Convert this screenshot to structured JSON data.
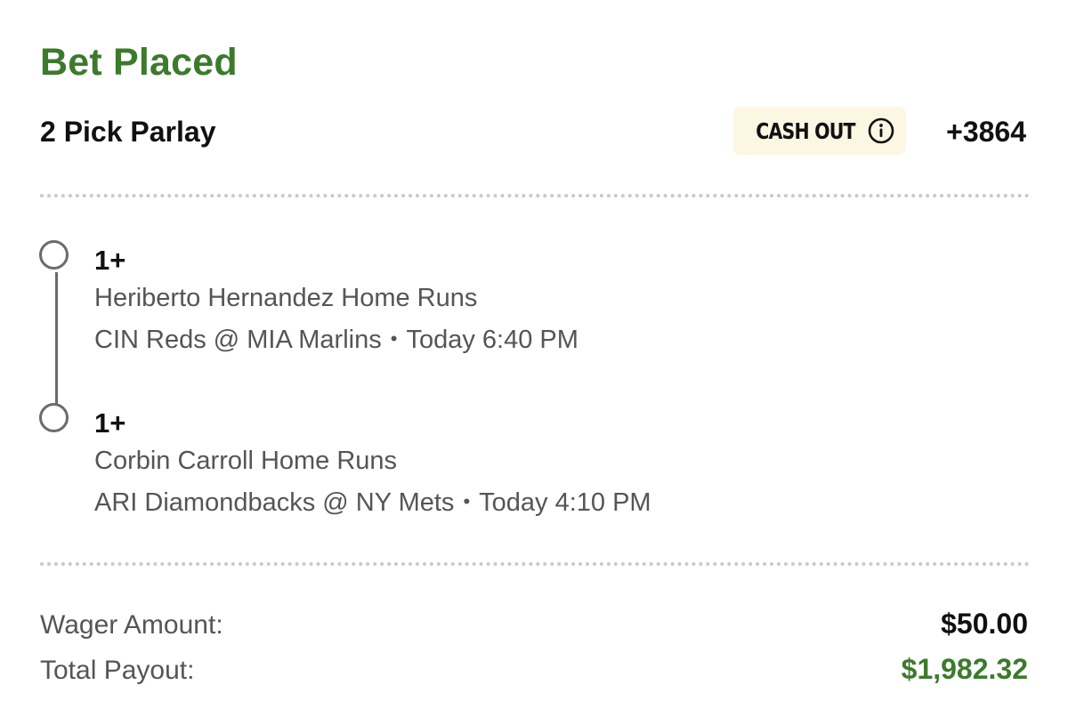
{
  "header": {
    "title": "Bet Placed",
    "bet_type": "2 Pick Parlay",
    "cashout_label": "CASH OUT",
    "odds": "+3864"
  },
  "legs": [
    {
      "line": "1+",
      "market": "Heriberto Hernandez Home Runs",
      "game": "CIN Reds @ MIA Marlins",
      "separator": "•",
      "time": "Today 6:40 PM"
    },
    {
      "line": "1+",
      "market": "Corbin Carroll Home Runs",
      "game": "ARI Diamondbacks @ NY Mets",
      "separator": "•",
      "time": "Today 4:10 PM"
    }
  ],
  "summary": {
    "wager_label": "Wager Amount:",
    "wager_value": "$50.00",
    "payout_label": "Total Payout:",
    "payout_value": "$1,982.32"
  },
  "colors": {
    "accent_green": "#3c7a2c",
    "cashout_bg": "#fbf7e3",
    "secondary_text": "#555555"
  },
  "icons": {
    "info": "info-circle-icon",
    "leg_status": "open-circle-icon"
  }
}
